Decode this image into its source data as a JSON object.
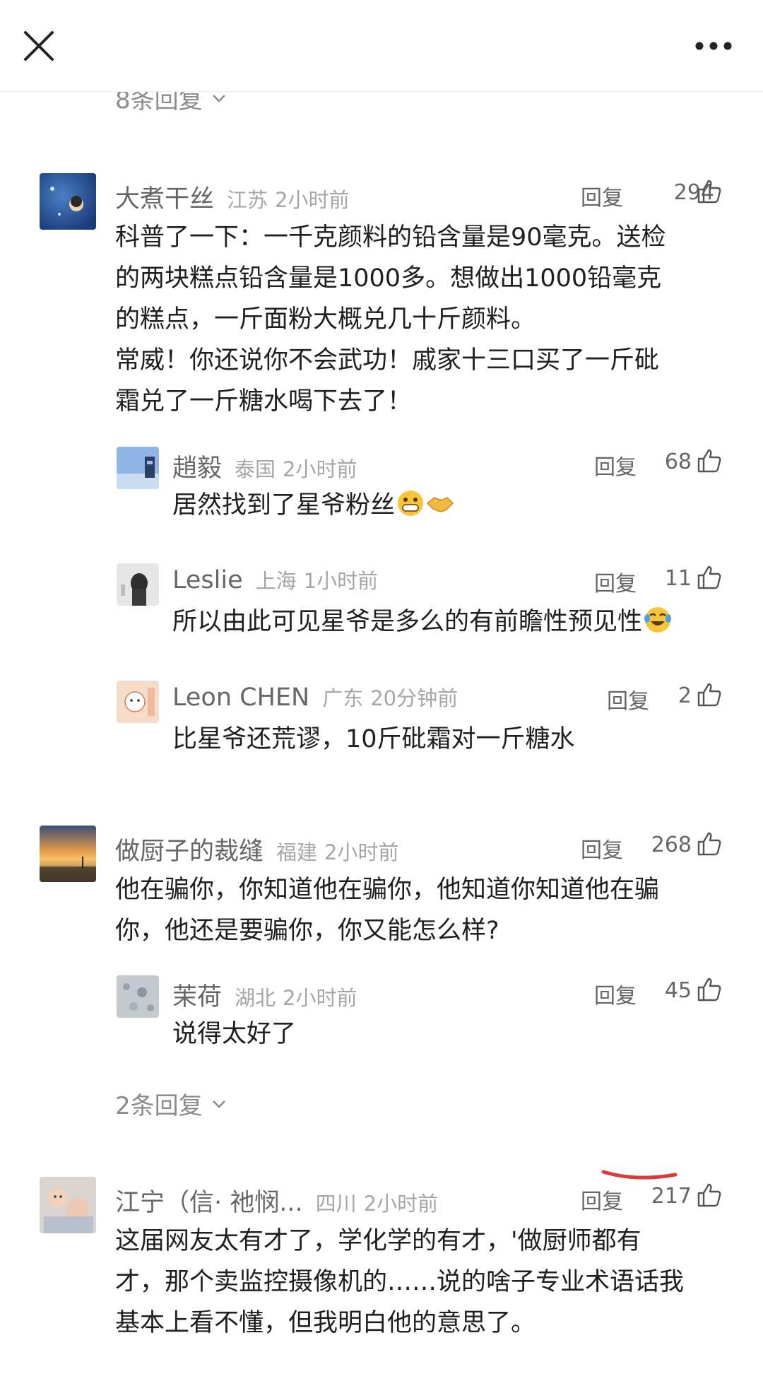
{
  "header": {
    "close_icon": "close-icon",
    "more_icon": "more-horizontal-icon"
  },
  "top_replies_link": "8条回复",
  "reply_label": "回复",
  "comments": [
    {
      "name": "大煮干丝",
      "location": "江苏",
      "time": "2小时前",
      "likes": "294",
      "lines": [
        "科普了一下：一千克颜料的铅含量是90毫克。送检",
        "的两块糕点铅含量是1000多。想做出1000铅毫克",
        "的糕点，一斤面粉大概兑几十斤颜料。",
        "常威！你还说你不会武功！戚家十三口买了一斤砒",
        "霜兑了一斤糖水喝下去了！"
      ],
      "replies": [
        {
          "name": "趙毅",
          "location": "泰国",
          "time": "2小时前",
          "likes": "68",
          "text": "居然找到了星爷粉丝",
          "emojis": [
            "grin-emoji",
            "handshake-emoji"
          ]
        },
        {
          "name": "Leslie",
          "location": "上海",
          "time": "1小时前",
          "likes": "11",
          "text": "所以由此可见星爷是多么的有前瞻性预见性",
          "emojis": [
            "crying-laughing-emoji"
          ]
        },
        {
          "name": "Leon CHEN",
          "location": "广东",
          "time": "20分钟前",
          "likes": "2",
          "text": "比星爷还荒谬，10斤砒霜对一斤糖水",
          "emojis": []
        }
      ]
    },
    {
      "name": "做厨子的裁缝",
      "location": "福建",
      "time": "2小时前",
      "likes": "268",
      "lines": [
        "他在骗你，你知道他在骗你，他知道你知道他在骗",
        "你，他还是要骗你，你又能怎么样?"
      ],
      "replies": [
        {
          "name": "茉荷",
          "location": "湖北",
          "time": "2小时前",
          "likes": "45",
          "text": "说得太好了",
          "emojis": []
        }
      ],
      "more_replies": "2条回复"
    },
    {
      "name": "江宁（信· 祂悯...",
      "location": "四川",
      "time": "2小时前",
      "likes": "217",
      "lines": [
        "这届网友太有才了，学化学的有才，'做厨师都有",
        "才，那个卖监控摄像机的……说的啥子专业术语话我",
        "基本上看不懂，但我明白他的意思了。"
      ]
    }
  ],
  "colors": {
    "text": "#1f1f1f",
    "secondary": "#666666",
    "meta": "#a6a6a6",
    "annotation_red": "#d93a3a"
  }
}
